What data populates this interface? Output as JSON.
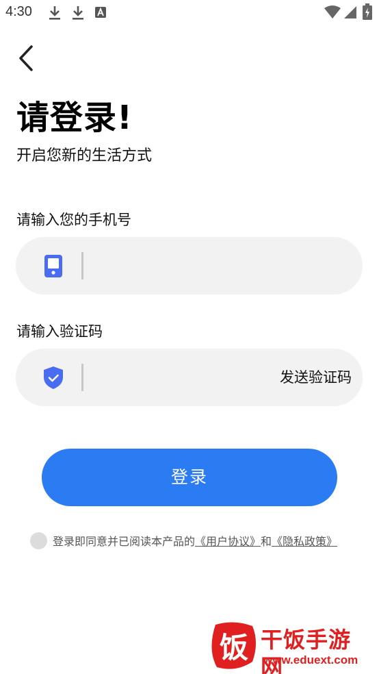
{
  "status_bar": {
    "time": "4:30",
    "icons": [
      "download-icon",
      "download-icon",
      "keyboard-a-icon",
      "wifi-icon",
      "signal-icon",
      "battery-charging-icon"
    ]
  },
  "header": {
    "back_icon": "chevron-left-icon"
  },
  "title": "请登录!",
  "subtitle": "开启您新的生活方式",
  "phone_field": {
    "label": "请输入您的手机号",
    "value": "",
    "placeholder": "",
    "icon": "phone-icon"
  },
  "code_field": {
    "label": "请输入验证码",
    "value": "",
    "placeholder": "",
    "icon": "shield-check-icon",
    "send_button": "发送验证码"
  },
  "login_button": "登录",
  "agreement": {
    "text": "登录即同意并已阅读本产品的",
    "user_agreement": "《用户协议》",
    "and": "和",
    "privacy_policy": "《隐私政策》"
  },
  "watermark": {
    "mark": "饭",
    "name": "干饭手游网",
    "url": "www.eduext.com"
  },
  "colors": {
    "accent": "#2b7bf2",
    "icon_blue": "#4a6cf0",
    "input_bg": "#f2f2f2",
    "watermark_red": "#e02020"
  }
}
